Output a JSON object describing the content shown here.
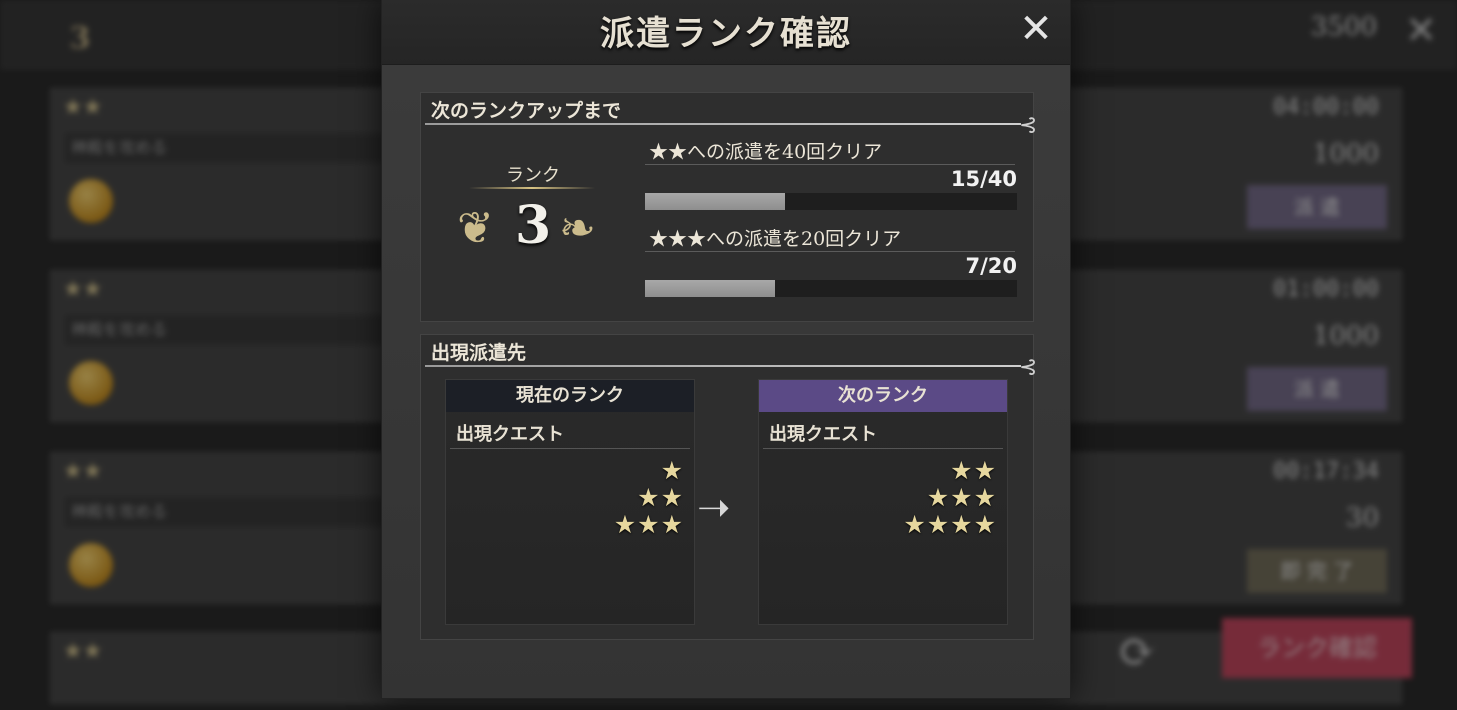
{
  "background": {
    "rank_value": "3",
    "coin_amount": "3500",
    "cards": [
      {
        "stars": "★★",
        "name": "神殿を攻める",
        "timer": "04:00:00",
        "cost": "1000",
        "button": "派 遣"
      },
      {
        "stars": "★★",
        "name": "神殿を攻める",
        "timer": "01:00:00",
        "cost": "1000",
        "button": "派 遣"
      },
      {
        "stars": "★★",
        "name": "神殿を攻める",
        "timer": "00:17:34",
        "cost": "30",
        "button": "即 完 了"
      },
      {
        "stars": "★★",
        "name": "",
        "timer": "",
        "cost": "",
        "button": ""
      }
    ],
    "rank_confirm_button": "ランク確認"
  },
  "dialog": {
    "title": "派遣ランク確認",
    "close_icon": "close-icon",
    "next_rankup": {
      "heading": "次のランクアップまで",
      "rank_label": "ランク",
      "rank_value": "3",
      "conditions": [
        {
          "text": "★★への派遣を40回クリア",
          "count": "15/40",
          "progress": 0.375
        },
        {
          "text": "★★★への派遣を20回クリア",
          "count": "7/20",
          "progress": 0.35
        }
      ]
    },
    "destinations": {
      "heading": "出現派遣先",
      "current": {
        "label": "現在のランク",
        "sub": "出現クエスト",
        "star_rows": [
          "★",
          "★★",
          "★★★"
        ]
      },
      "next": {
        "label": "次のランク",
        "sub": "出現クエスト",
        "star_rows": [
          "★★",
          "★★★",
          "★★★★"
        ]
      }
    }
  },
  "colors": {
    "accent_purple": "#5b4a86",
    "star_gold": "#e6d79e",
    "rank_button_red": "#c23a54"
  }
}
